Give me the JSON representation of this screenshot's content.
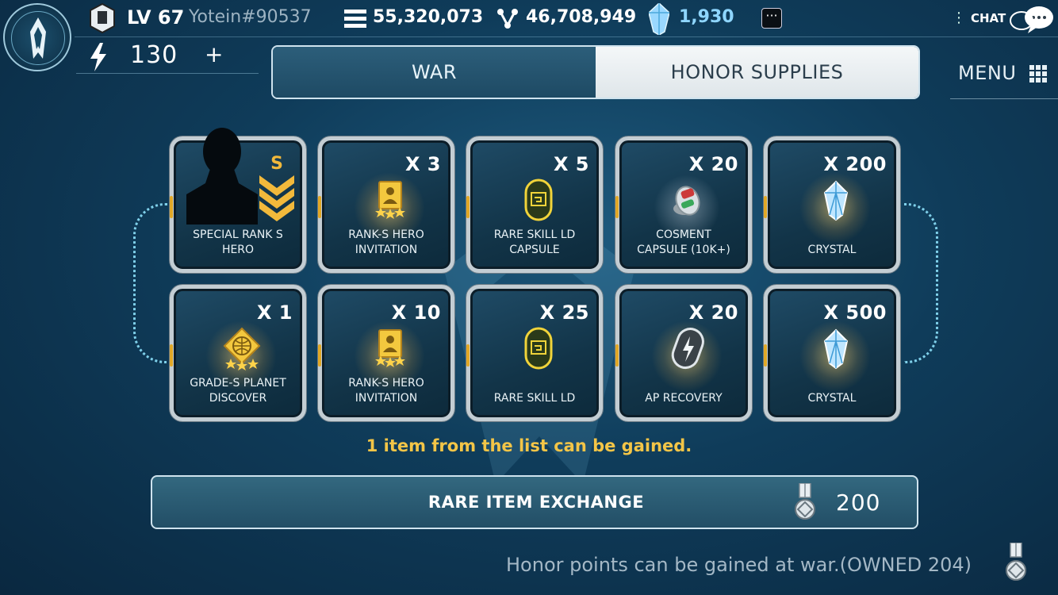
{
  "header": {
    "level": "LV 67",
    "username": "Yotein#90537",
    "resources": [
      {
        "icon": "metal-stack-icon",
        "value": "55,320,073"
      },
      {
        "icon": "molecule-icon",
        "value": "46,708,949"
      },
      {
        "icon": "crystal-icon",
        "value": "1,930",
        "color": "#7fd0ff"
      }
    ],
    "energy": "130",
    "energy_plus": "+",
    "more_label": "···",
    "chat_label": "CHAT"
  },
  "tabs": [
    {
      "label": "WAR",
      "active": false
    },
    {
      "label": "HONOR SUPPLIES",
      "active": true
    }
  ],
  "menu_label": "MENU",
  "items": [
    {
      "qty": "",
      "label_1": "SPECIAL RANK S",
      "label_2": "HERO",
      "icon": "hero-silhouette-icon"
    },
    {
      "qty": "X 3",
      "label_1": "RANK-S HERO",
      "label_2": "INVITATION",
      "icon": "hero-invitation-icon"
    },
    {
      "qty": "X 5",
      "label_1": "RARE SKILL LD",
      "label_2": "CAPSULE",
      "icon": "skill-capsule-icon"
    },
    {
      "qty": "X 20",
      "label_1": "COSMENT",
      "label_2": "CAPSULE (10K+)",
      "icon": "cosment-capsule-icon"
    },
    {
      "qty": "X 200",
      "label_1": "CRYSTAL",
      "label_2": "",
      "icon": "crystal-icon"
    },
    {
      "qty": "X 1",
      "label_1": "GRADE-S PLANET",
      "label_2": "DISCOVER",
      "icon": "planet-discover-icon"
    },
    {
      "qty": "X 10",
      "label_1": "RANK-S HERO",
      "label_2": "INVITATION",
      "icon": "hero-invitation-icon"
    },
    {
      "qty": "X 25",
      "label_1": "RARE SKILL LD",
      "label_2": "",
      "icon": "skill-ld-icon"
    },
    {
      "qty": "X 20",
      "label_1": "AP RECOVERY",
      "label_2": "",
      "icon": "ap-recovery-icon"
    },
    {
      "qty": "X 500",
      "label_1": "CRYSTAL",
      "label_2": "",
      "icon": "crystal-icon"
    }
  ],
  "hint": "1 item from the list can be gained.",
  "exchange": {
    "label": "RARE ITEM EXCHANGE",
    "cost": "200"
  },
  "footer": "Honor points can be gained at war.(OWNED 204)",
  "colors": {
    "accent_gold": "#f3c547",
    "card_border": "#c3cdd3",
    "energy_dash": "#7fd0ea"
  }
}
